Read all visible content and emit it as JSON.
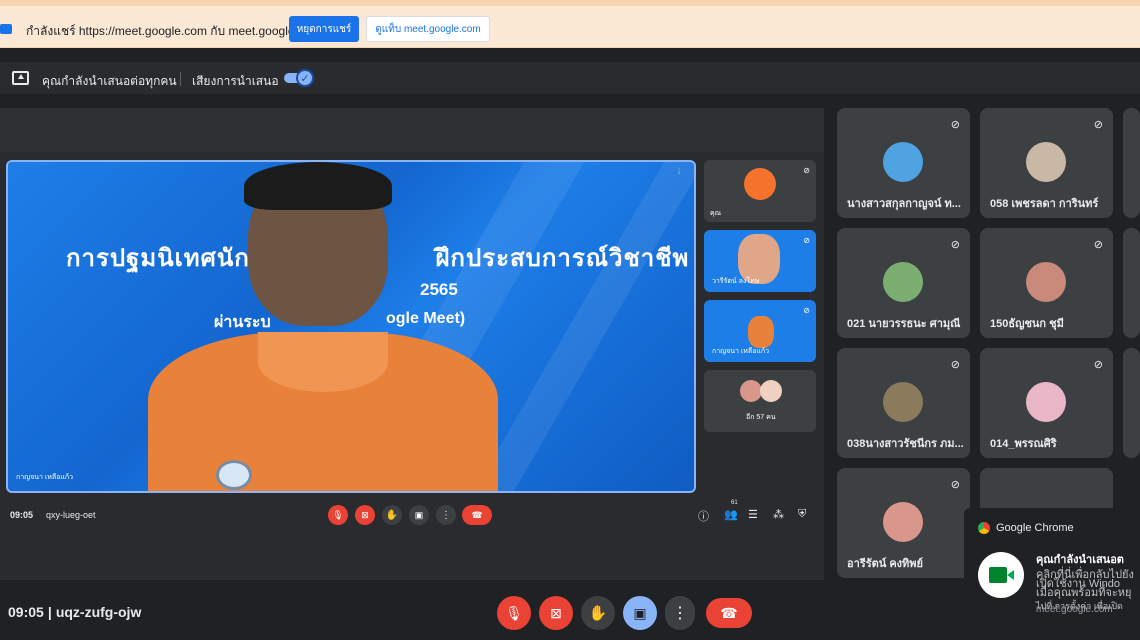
{
  "share_bar": {
    "text": "กำลังแชร์ https://meet.google.com กับ meet.google.com",
    "stop_label": "หยุดการแชร์",
    "view_label": "ดูแท็บ meet.google.com"
  },
  "presenting_bar": {
    "text": "คุณกำลังนำเสนอต่อทุกคน",
    "audio_label": "เสียงการนำเสนอ",
    "audio_on": true
  },
  "inner_meeting": {
    "main_speaker": {
      "slide_title": "การปฐมนิเทศนักเรียน",
      "slide_title_right": "ฝึกประสบการณ์วิชาชีพ",
      "slide_year": "2565",
      "slide_platform": "ogle Meet)",
      "slide_left1": "ภา",
      "slide_left2": "ผ่านระบ",
      "name": "กาญจนา เหลือแก้ว"
    },
    "side_tiles": [
      {
        "name": "คุณ"
      },
      {
        "name": "วารีรัตน์ ลงโทษ"
      },
      {
        "name": "กาญจนา เหลือแก้ว"
      },
      {
        "name": "อีก 57 คน"
      }
    ],
    "time": "09:05",
    "code": "qxy-lueg-oet",
    "people_count": "61"
  },
  "participants": [
    {
      "name": "นางสาวสกุลกาญจน์ ท...",
      "avatar_color": "#4fa3e0"
    },
    {
      "name": "058 เพชรลดา การินทร์",
      "avatar_color": "#c9b8a6"
    },
    {
      "name": "021 นายวรรธนะ ศามุณี",
      "avatar_color": "#7cae72"
    },
    {
      "name": "150ธัญชนก ชุมี",
      "avatar_color": "#c98a7c"
    },
    {
      "name": "038นางสาวรัชนีกร ภม...",
      "avatar_color": "#8c7a5c"
    },
    {
      "name": "014_พรรณศิริ",
      "avatar_color": "#e8b6c6"
    },
    {
      "name": "อารีรัตน์ คงทิพย์",
      "avatar_color": "#d9968a"
    }
  ],
  "meeting": {
    "time": "09:05",
    "code": "uqz-zufg-ojw"
  },
  "notification": {
    "app": "Google Chrome",
    "title": "คุณกำลังนำเสนอต",
    "line1": "คลิกที่นี่เพื่อกลับไปยัง",
    "line2": "เปิดใช้งาน Windo",
    "line3": "เมื่อคุณพร้อมที่จะหยุ",
    "line4": "ไปที่ การตั้งค่า เพื่อเปิด",
    "source": "meet.google.com"
  }
}
